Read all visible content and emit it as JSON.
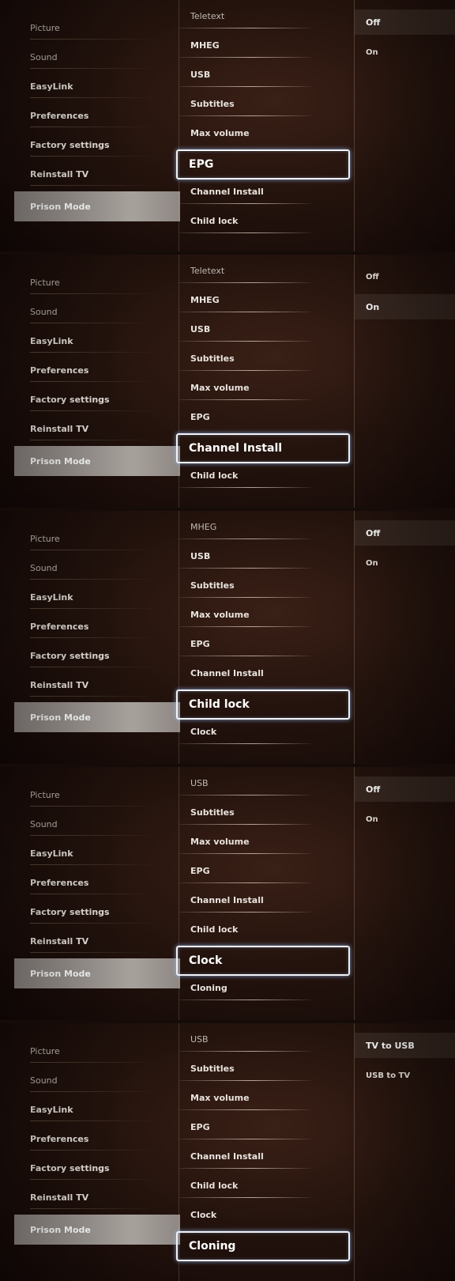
{
  "panels": [
    {
      "left_items": [
        "Picture",
        "Sound",
        "EasyLink",
        "Preferences",
        "Factory settings",
        "Reinstall TV",
        "Prison Mode"
      ],
      "left_selected": 6,
      "middle_items": [
        "Teletext",
        "MHEG",
        "USB",
        "Subtitles",
        "Max volume",
        "EPG",
        "Channel Install",
        "Child lock"
      ],
      "middle_selected": 5,
      "right_items": [
        "Off",
        "On"
      ],
      "right_highlighted": 0
    },
    {
      "left_items": [
        "Picture",
        "Sound",
        "EasyLink",
        "Preferences",
        "Factory settings",
        "Reinstall TV",
        "Prison Mode"
      ],
      "left_selected": 6,
      "middle_items": [
        "Teletext",
        "MHEG",
        "USB",
        "Subtitles",
        "Max volume",
        "EPG",
        "Channel Install",
        "Child lock"
      ],
      "middle_selected": 6,
      "right_items": [
        "Off",
        "On"
      ],
      "right_highlighted": 1
    },
    {
      "left_items": [
        "Picture",
        "Sound",
        "EasyLink",
        "Preferences",
        "Factory settings",
        "Reinstall TV",
        "Prison Mode"
      ],
      "left_selected": 6,
      "middle_items": [
        "MHEG",
        "USB",
        "Subtitles",
        "Max volume",
        "EPG",
        "Channel Install",
        "Child lock",
        "Clock"
      ],
      "middle_selected": 6,
      "right_items": [
        "Off",
        "On"
      ],
      "right_highlighted": 0
    },
    {
      "left_items": [
        "Picture",
        "Sound",
        "EasyLink",
        "Preferences",
        "Factory settings",
        "Reinstall TV",
        "Prison Mode"
      ],
      "left_selected": 6,
      "middle_items": [
        "USB",
        "Subtitles",
        "Max volume",
        "EPG",
        "Channel Install",
        "Child lock",
        "Clock",
        "Cloning"
      ],
      "middle_selected": 6,
      "right_items": [
        "Off",
        "On"
      ],
      "right_highlighted": 0
    },
    {
      "left_items": [
        "Picture",
        "Sound",
        "EasyLink",
        "Preferences",
        "Factory settings",
        "Reinstall TV",
        "Prison Mode"
      ],
      "left_selected": 6,
      "middle_items": [
        "USB",
        "Subtitles",
        "Max volume",
        "EPG",
        "Channel Install",
        "Child lock",
        "Clock",
        "Cloning"
      ],
      "middle_selected": 7,
      "right_items": [
        "TV to USB",
        "USB to TV"
      ],
      "right_highlighted": 0
    }
  ]
}
